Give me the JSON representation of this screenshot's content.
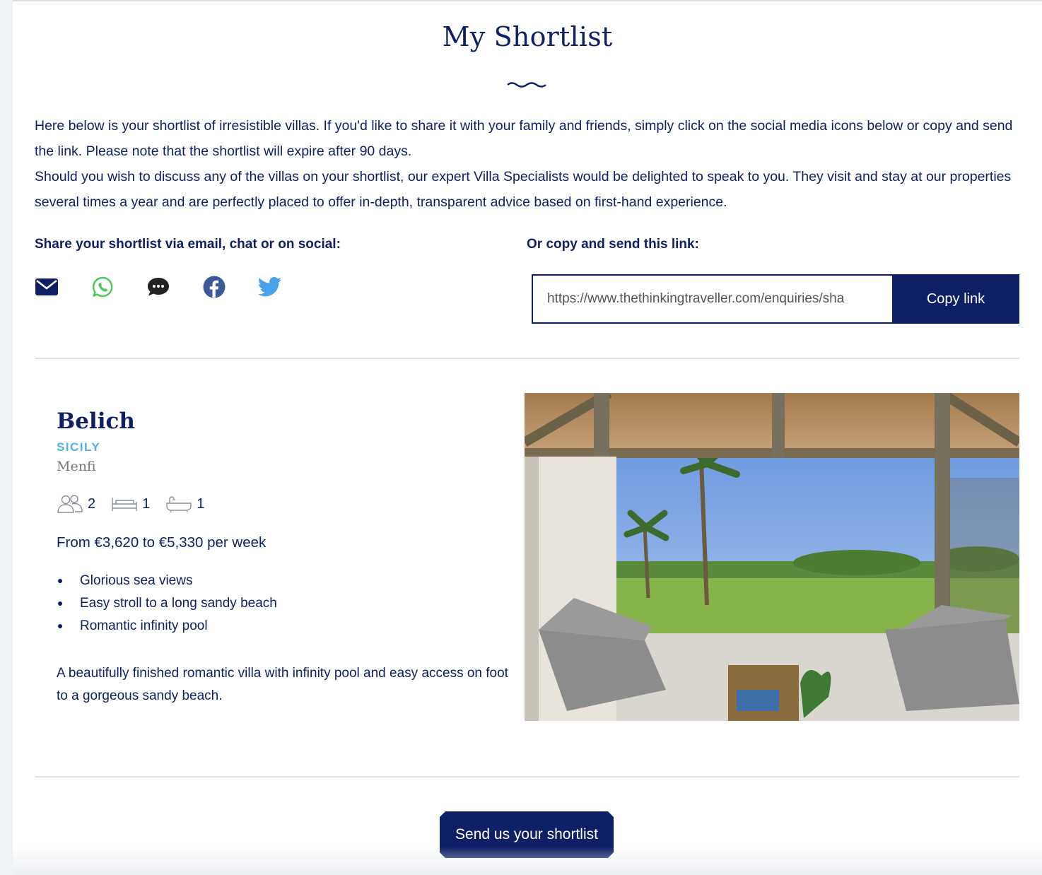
{
  "page": {
    "title": "My Shortlist",
    "intro_paragraphs": [
      "Here below is your shortlist of irresistible villas. If you'd like to share it with your family and friends, simply click on the social media icons below or copy and send the link. Please note that the shortlist will expire after 90 days.",
      "Should you wish to discuss any of the villas on your shortlist, our expert Villa Specialists would be delighted to speak to you. They visit and stay at our properties several times a year and are perfectly placed to offer in-depth, transparent advice based on first-hand experience."
    ]
  },
  "share": {
    "heading": "Share your shortlist via email, chat or on social:",
    "icons": [
      "email-icon",
      "whatsapp-icon",
      "chat-icon",
      "facebook-icon",
      "twitter-icon"
    ]
  },
  "copy": {
    "heading": "Or copy and send this link:",
    "link_value": "https://www.thethinkingtraveller.com/enquiries/sha",
    "button_label": "Copy link"
  },
  "villa": {
    "name": "Belich",
    "region": "SICILY",
    "town": "Menfi",
    "guests": "2",
    "bedrooms": "1",
    "bathrooms": "1",
    "price": "From €3,620 to €5,330 per week",
    "features": [
      "Glorious sea views",
      "Easy stroll to a long sandy beach",
      "Romantic infinity pool"
    ],
    "description": "A beautifully finished romantic villa with infinity pool and easy access on foot to a gorgeous sandy beach."
  },
  "footer": {
    "send_button_label": "Send us your shortlist"
  },
  "colors": {
    "navy": "#0f1f66",
    "region_blue": "#4fb3e8",
    "whatsapp_green": "#4ac959",
    "facebook_blue": "#3b5998",
    "twitter_blue": "#4aa1eb",
    "divider": "#d7e2ea"
  }
}
